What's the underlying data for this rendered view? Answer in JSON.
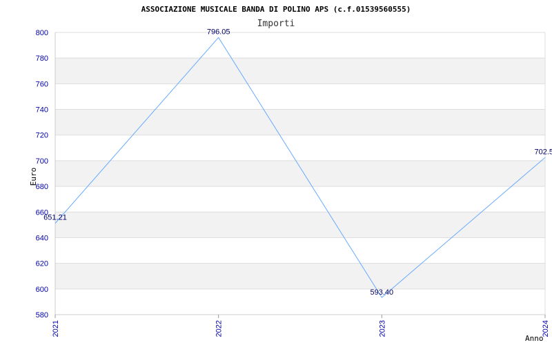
{
  "chart_data": {
    "type": "line",
    "title": "ASSOCIAZIONE MUSICALE BANDA DI POLINO APS (c.f.01539560555)",
    "subtitle": "Importi",
    "xlabel": "Anno",
    "ylabel": "Euro",
    "categories": [
      "2021",
      "2022",
      "2023",
      "2024"
    ],
    "series": [
      {
        "values": [
          651.21,
          796.05,
          593.4,
          702.5
        ]
      }
    ],
    "data_labels": [
      "651.21",
      "796.05",
      "593.40",
      "702.5"
    ],
    "ylim": [
      580,
      800
    ],
    "yticks": [
      "580",
      "600",
      "620",
      "640",
      "660",
      "680",
      "700",
      "720",
      "740",
      "760",
      "780",
      "800"
    ],
    "grid": true,
    "line_color": "#66aaff",
    "band_color": "#f2f2f2",
    "tick_color": "#0000aa"
  }
}
